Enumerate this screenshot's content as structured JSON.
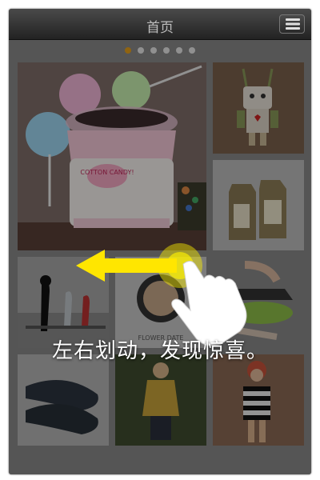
{
  "header": {
    "title": "首页",
    "menu_icon": "menu-icon"
  },
  "pager": {
    "page_count": 6,
    "active_index": 0,
    "active_color": "#e8a21c",
    "inactive_color": "#e9e9e9"
  },
  "tiles": [
    {
      "id": "cotton-candy-machine",
      "label_on_box": "COTTON CANDY!"
    },
    {
      "id": "robot-doll"
    },
    {
      "id": "tea-bags"
    },
    {
      "id": "bird-figures"
    },
    {
      "id": "compact-powder",
      "caption": "FLOWER DATE"
    },
    {
      "id": "kitchen-gadget"
    },
    {
      "id": "slippers"
    },
    {
      "id": "yellow-cardigan"
    },
    {
      "id": "striped-dress"
    }
  ],
  "overlay": {
    "hint_text": "左右划动，发现惊喜。",
    "gesture_icon": "swipe-left-hand-icon",
    "arrow_color": "#ffe600"
  }
}
